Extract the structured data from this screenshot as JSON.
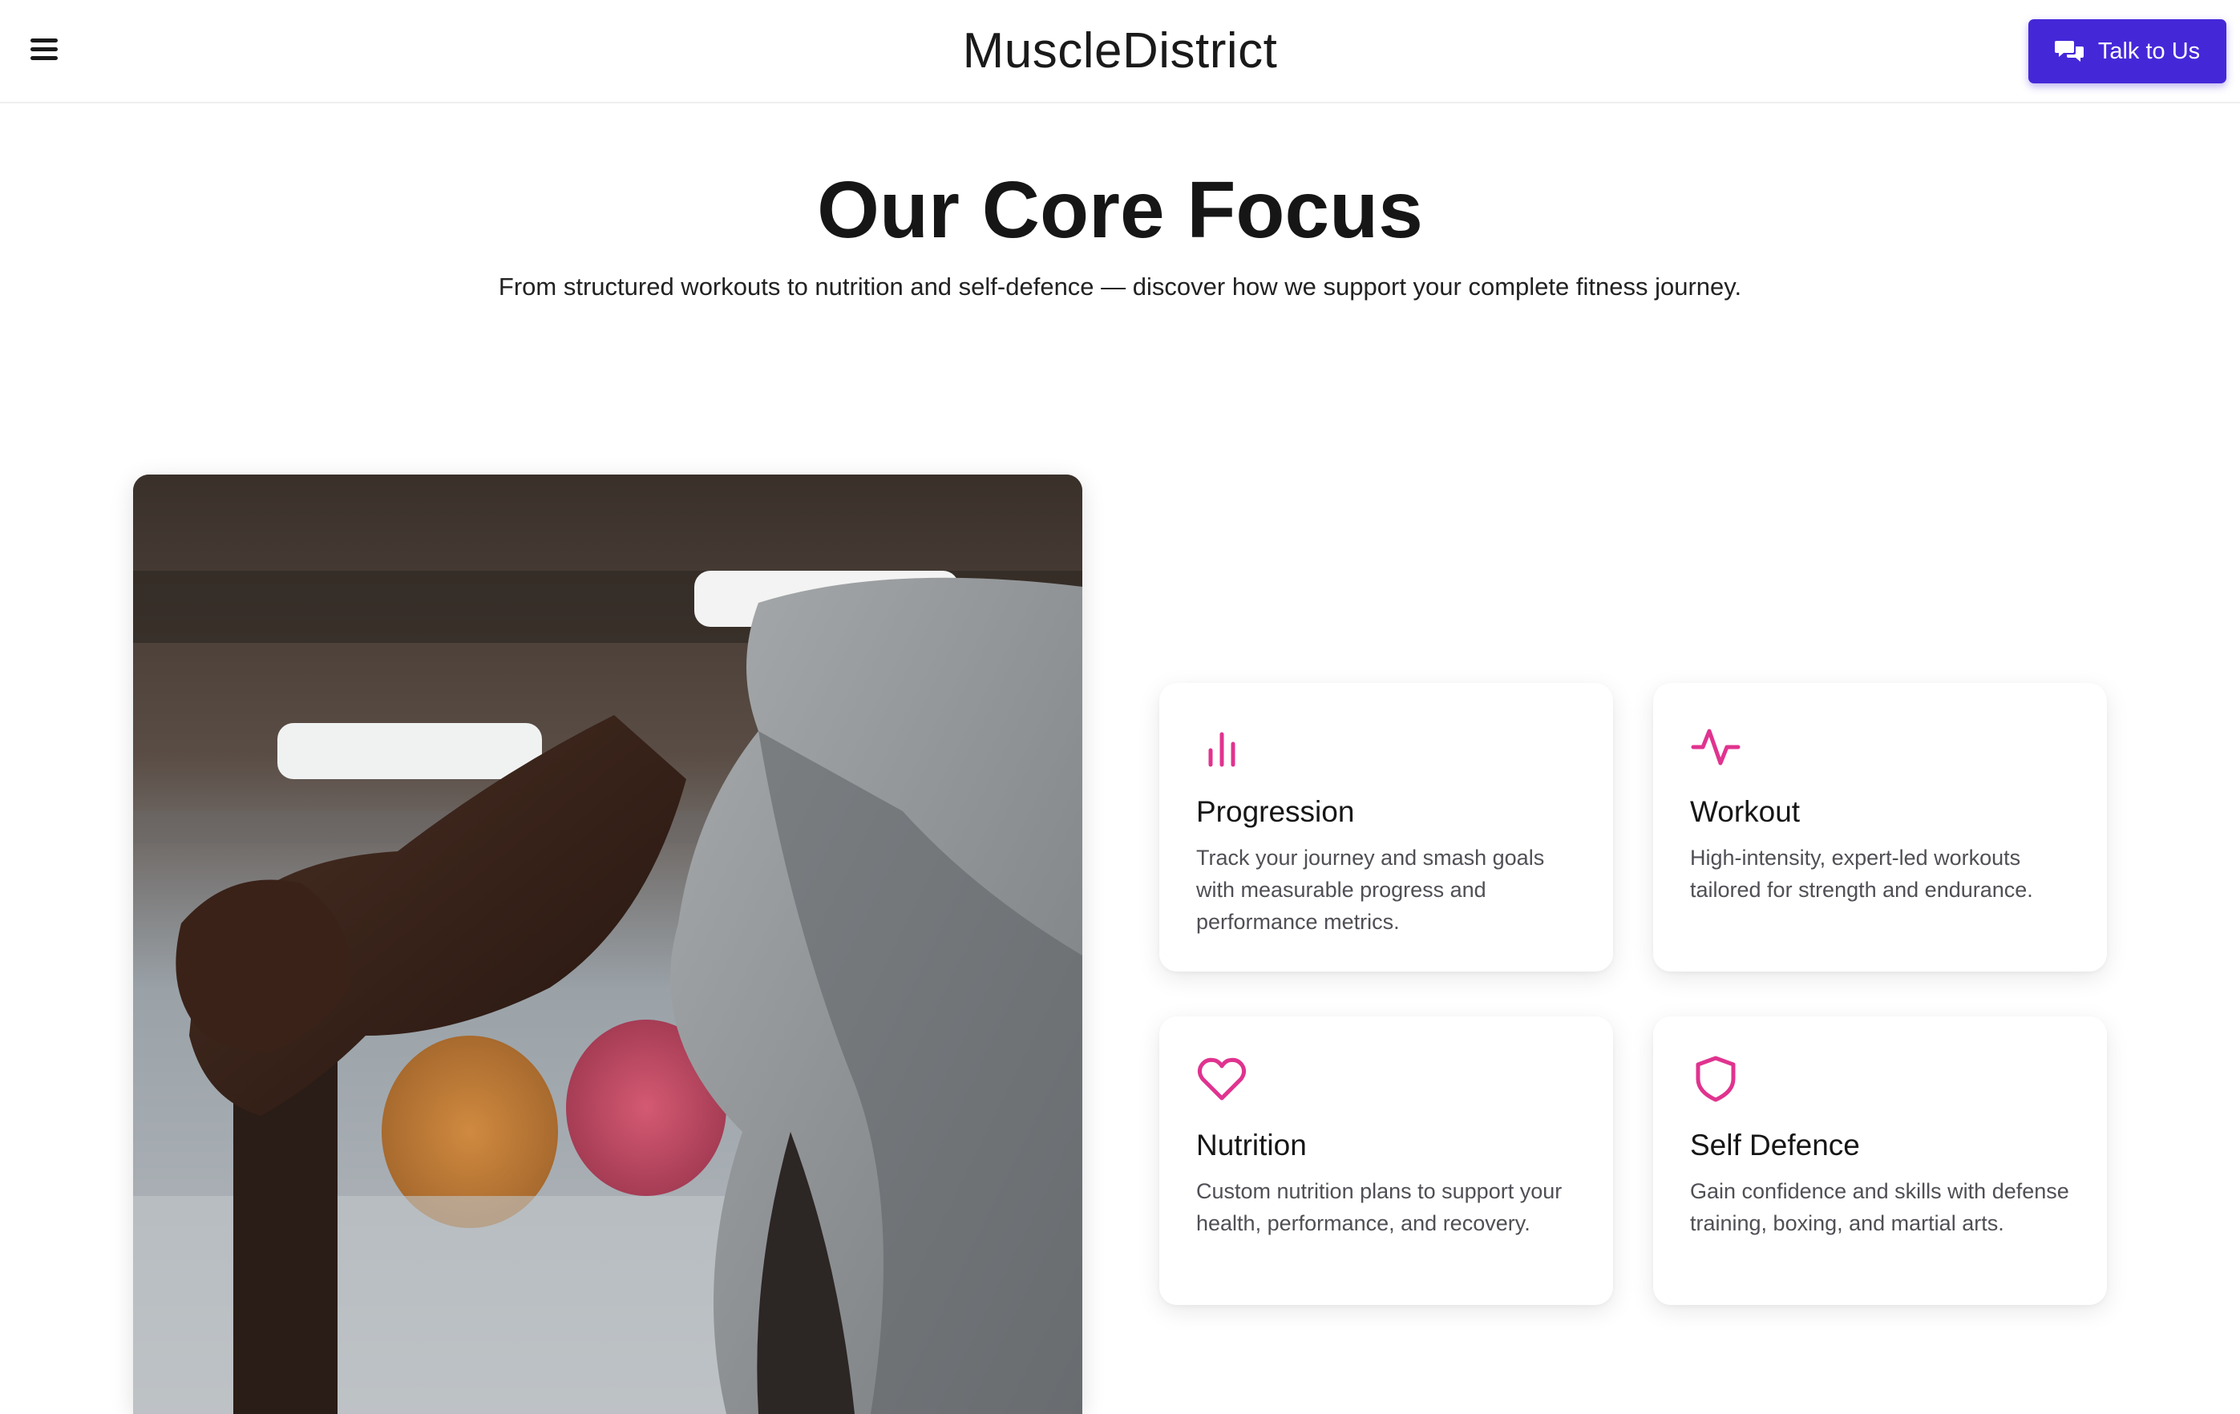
{
  "header": {
    "brand": "MuscleDistrict",
    "cta_label": "Talk to Us"
  },
  "intro": {
    "title": "Our Core Focus",
    "subtitle": "From structured workouts to nutrition and self-defence — discover how we support your complete fitness journey."
  },
  "features": [
    {
      "icon": "bar-chart-icon",
      "title": "Progression",
      "description": "Track your journey and smash goals with measurable progress and performance metrics."
    },
    {
      "icon": "activity-icon",
      "title": "Workout",
      "description": "High-intensity, expert-led workouts tailored for strength and endurance."
    },
    {
      "icon": "heart-icon",
      "title": "Nutrition",
      "description": "Custom nutrition plans to support your health, performance, and recovery."
    },
    {
      "icon": "shield-icon",
      "title": "Self Defence",
      "description": "Gain confidence and skills with defense training, boxing, and martial arts."
    }
  ],
  "colors": {
    "accent": "#4428d8",
    "icon": "#e0338f"
  }
}
